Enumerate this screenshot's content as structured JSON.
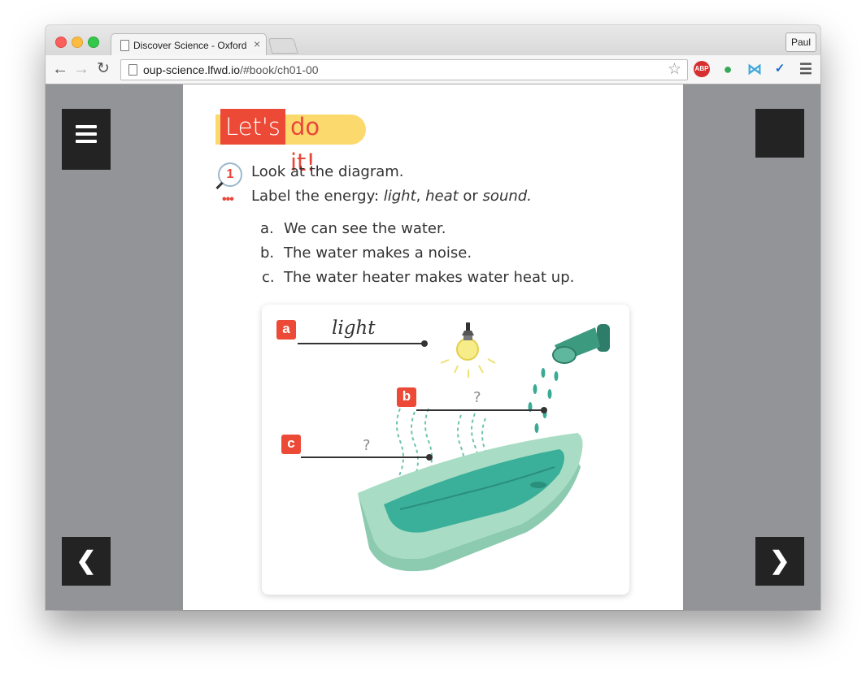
{
  "browser": {
    "tab_title": "Discover Science - Oxford",
    "tab_close": "×",
    "profile": "Paul",
    "url_host": "oup-science.lfwd.io",
    "url_path": "/#book/ch01-00",
    "extensions": [
      "abp-icon",
      "green-drop-icon",
      "bowtie-icon",
      "y-icon",
      "menu-icon"
    ],
    "abp_label": "ABP"
  },
  "reader": {
    "heading_part1": "Let's",
    "heading_part2": "do it!",
    "question_number": "1",
    "instruction1": "Look at the diagram.",
    "instruction2_prefix": "Label the energy: ",
    "instruction2_opt1": "light",
    "instruction2_sep1": ", ",
    "instruction2_opt2": "heat",
    "instruction2_sep2": " or ",
    "instruction2_opt3": "sound.",
    "items": [
      {
        "letter": "a.",
        "text": "We can see the water."
      },
      {
        "letter": "b.",
        "text": "The water makes a noise."
      },
      {
        "letter": "c.",
        "text": "The water heater makes water heat up."
      }
    ],
    "diagram": {
      "badge_a": "a",
      "badge_b": "b",
      "badge_c": "c",
      "answer_a": "light",
      "answer_b": "?",
      "answer_c": "?"
    }
  },
  "colors": {
    "accent_red": "#ec4a36",
    "accent_yellow": "#fbd96d",
    "reader_bg": "#939498",
    "nav_button": "#232323"
  }
}
